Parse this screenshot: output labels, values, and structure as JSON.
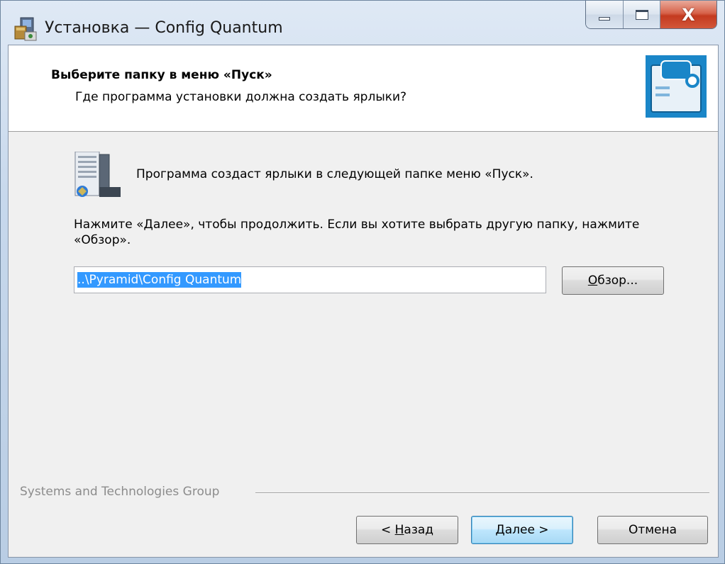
{
  "window": {
    "title": "Установка — Config Quantum",
    "icons": {
      "app": "installer-icon",
      "minimize": "minimize-icon",
      "maximize": "maximize-icon",
      "close": "close-icon"
    },
    "close_glyph": "X"
  },
  "header": {
    "title": "Выберите папку в меню «Пуск»",
    "subtitle": "Где программа установки должна создать ярлыки?",
    "image_icon": "wizard-header-image"
  },
  "body": {
    "folder_icon": "start-menu-folder-icon",
    "info_text": "Программа создаст ярлыки в следующей папке меню «Пуск».",
    "instruction_text": "Нажмите «Далее», чтобы продолжить. Если вы хотите выбрать другую папку, нажмите «Обзор».",
    "path_value": "..\\Pyramid\\Config Quantum",
    "browse_label_accel": "О",
    "browse_label_rest": "бзор..."
  },
  "footer": {
    "brand": "Systems and Technologies Group",
    "back_prefix": "< ",
    "back_accel": "Н",
    "back_rest": "азад",
    "next_accel": "Д",
    "next_rest": "алее >",
    "cancel_label": "Отмена"
  },
  "colors": {
    "accent_blue": "#1a86c8",
    "selection": "#3399ff",
    "close_red": "#c43a1f"
  }
}
